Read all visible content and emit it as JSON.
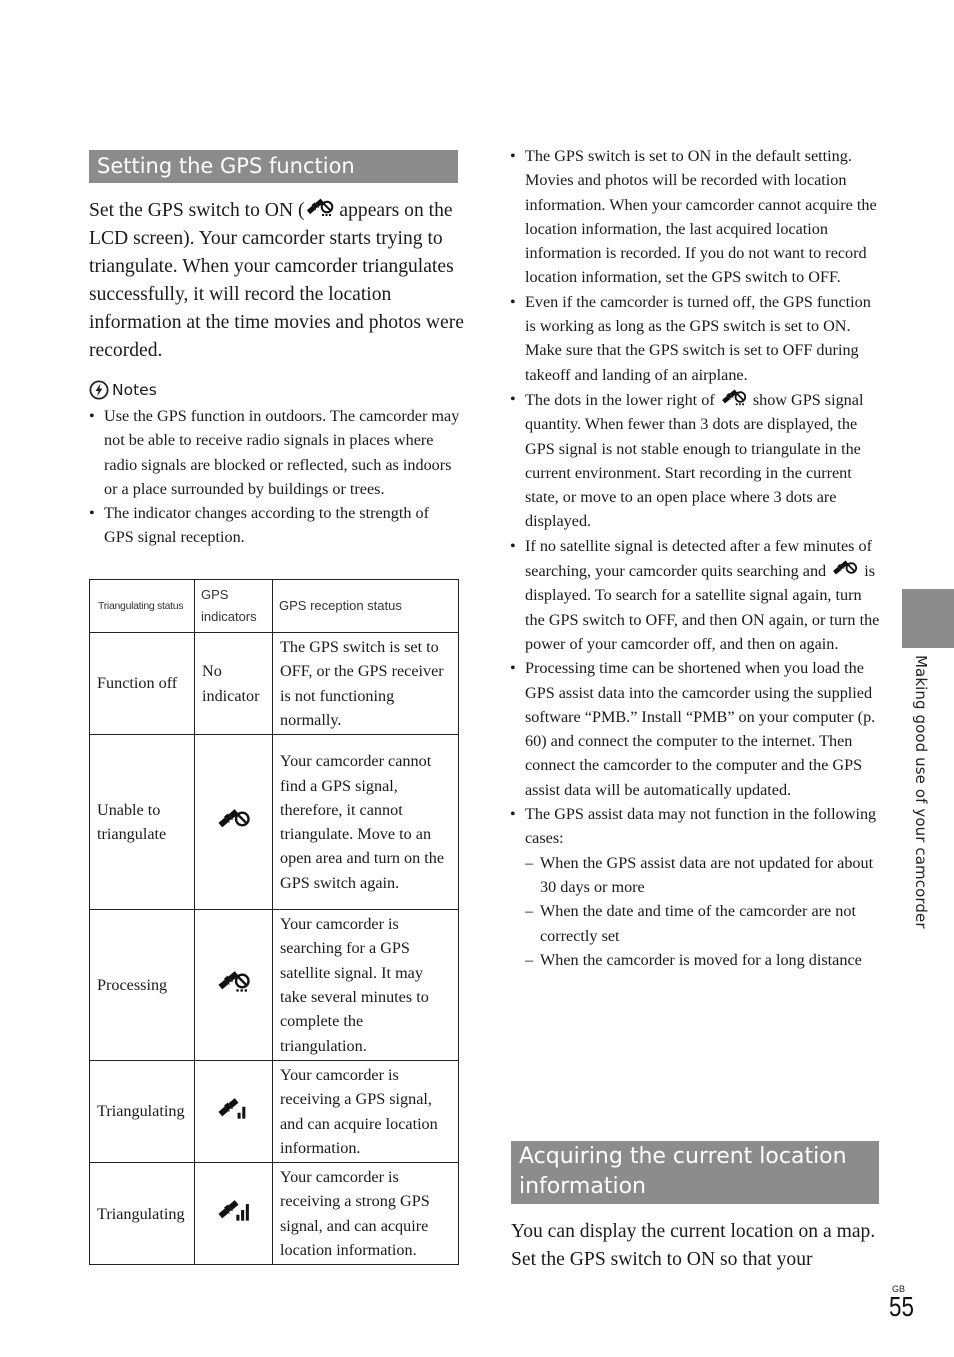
{
  "left_column": {
    "section_title": "Setting the GPS function",
    "intro_before_icon": "Set the GPS switch to ON (",
    "intro_icon": "gps-processing-icon",
    "intro_after_icon": " appears on the LCD screen). Your camcorder starts trying to triangulate. When your camcorder triangulates successfully, it will record the location information at the time movies and photos were recorded.",
    "notes_title": "Notes",
    "notes_icon": "notes-icon",
    "notes": [
      "Use the GPS function in outdoors. The camcorder may not be able to receive radio signals in places where radio signals are blocked or reflected, such as indoors or a place surrounded by buildings or trees.",
      "The indicator changes according to the strength of GPS signal reception."
    ],
    "table": {
      "headers": [
        "Triangulating status",
        "GPS indicators",
        "GPS reception status"
      ],
      "rows": [
        {
          "status": "Function off",
          "indicator_text": "No indicator",
          "indicator_icon": "",
          "reception": "The GPS switch is set to OFF, or the GPS receiver is not functioning normally."
        },
        {
          "status": "Unable to triangulate",
          "indicator_text": "",
          "indicator_icon": "gps-unable-icon",
          "reception": "Your camcorder cannot find a GPS signal, therefore, it cannot triangulate. Move to an open area and turn on the GPS switch again."
        },
        {
          "status": "Processing",
          "indicator_text": "",
          "indicator_icon": "gps-processing-icon",
          "reception": "Your camcorder is searching for a GPS satellite signal. It may take several minutes to complete the triangulation."
        },
        {
          "status": "Triangulating",
          "indicator_text": "",
          "indicator_icon": "gps-signal-medium-icon",
          "reception": "Your camcorder is receiving a GPS signal, and can acquire location information."
        },
        {
          "status": "Triangulating",
          "indicator_text": "",
          "indicator_icon": "gps-signal-strong-icon",
          "reception": "Your camcorder is receiving a strong GPS signal, and can acquire location information."
        }
      ]
    }
  },
  "right_column": {
    "bullets": [
      {
        "text": "The GPS switch is set to ON in the default setting. Movies and photos will be recorded with location information. When your camcorder cannot acquire the location information, the last acquired location information is recorded. If you do not want to record location information, set the GPS switch to OFF."
      },
      {
        "text": "Even if the camcorder is turned off, the GPS function is working as long as the GPS switch is set to ON. Make sure that the GPS switch is set to OFF during takeoff and landing of an airplane."
      },
      {
        "before": "The dots in the lower right of ",
        "icon": "gps-processing-icon",
        "after": " show GPS signal quantity. When fewer than 3 dots are displayed, the GPS signal is not stable enough to triangulate in the current environment. Start recording in the current state, or move to an open place where 3 dots are displayed."
      },
      {
        "before": "If no satellite signal is detected after a few minutes of searching, your camcorder quits searching and ",
        "icon": "gps-unable-icon",
        "after": " is displayed. To search for a satellite signal again, turn the GPS switch to OFF, and then ON again, or turn the power of your camcorder off, and then on again."
      },
      {
        "text": "Processing time can be shortened when you load the GPS assist data into the camcorder using the supplied software “PMB.” Install “PMB” on your computer (p. 60) and connect the computer to the internet. Then connect the camcorder to the computer and the GPS assist data will be automatically updated."
      },
      {
        "text": "The GPS assist data may not function in the following cases:",
        "sub": [
          "When the GPS assist data are not updated for about 30 days or more",
          "When the date and time of the camcorder are not correctly set",
          "When the camcorder is moved for a long distance"
        ]
      }
    ],
    "section2_title": "Acquiring the current location information",
    "section2_intro": "You can display the current location on a map. Set the GPS switch to ON so that your"
  },
  "side_tab": {
    "label": "Making good use of your camcorder",
    "color": "#8c8c8c"
  },
  "footer": {
    "region": "GB",
    "page_number": "55"
  }
}
